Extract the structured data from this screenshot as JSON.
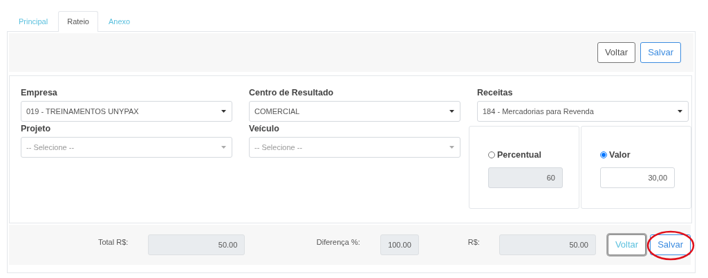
{
  "tabs": [
    {
      "label": "Principal",
      "selected": false
    },
    {
      "label": "Rateio",
      "selected": true
    },
    {
      "label": "Anexo",
      "selected": false
    }
  ],
  "toolbar_buttons": [
    {
      "label": "Voltar",
      "kind": "secondary"
    },
    {
      "label": "Salvar",
      "kind": "primary"
    }
  ],
  "fields": [
    {
      "label": "Empresa",
      "value": "019 - TREINAMENTOS UNYPAX"
    },
    {
      "label": "Centro de Resultado",
      "value": "COMERCIAL"
    },
    {
      "label": "Receitas",
      "value": "184 - Mercadorias para Revenda"
    },
    {
      "label": "Projeto",
      "placeholder": "-- Selecione --"
    },
    {
      "label": "Veículo",
      "placeholder": "-- Selecione --"
    }
  ],
  "modes": [
    {
      "label": "Percentual",
      "selected": false,
      "value": "60",
      "disabled": true
    },
    {
      "label": "Valor",
      "selected": true,
      "value": "30,00",
      "disabled": false
    }
  ],
  "totals": [
    {
      "label": "Total R$:",
      "value": "50.00"
    },
    {
      "label": "Diferença %:",
      "value": "100.00"
    },
    {
      "label": "R$:",
      "value": "50.00"
    }
  ],
  "footer_buttons": [
    {
      "label": "Voltar",
      "kind": "info",
      "focused": true,
      "circled": false
    },
    {
      "label": "Salvar",
      "kind": "primary",
      "focused": false,
      "circled": true
    }
  ]
}
